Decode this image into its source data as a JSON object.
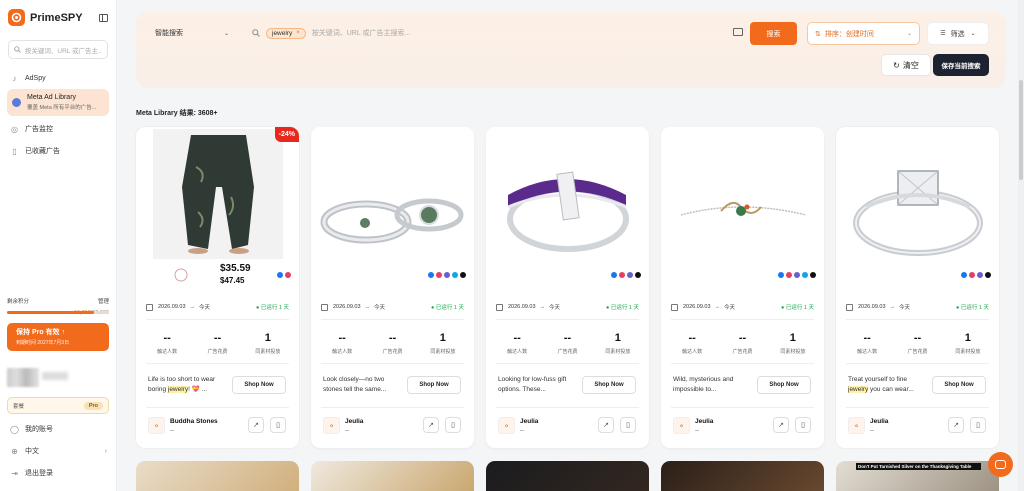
{
  "app": {
    "name": "PrimeSPY"
  },
  "sidebar": {
    "search_placeholder": "按关键词、URL 或广告主...",
    "items": [
      {
        "label": "AdSpy"
      },
      {
        "label": "Meta Ad Library",
        "sublabel": "覆盖 Meta 所有平台的广告..."
      },
      {
        "label": "广告监控"
      },
      {
        "label": "已收藏广告"
      }
    ],
    "credits": {
      "label": "剩余积分",
      "action": "管理",
      "used": "16,952",
      "total": "/20,000",
      "fraction": 0.85
    },
    "pro_button": {
      "label": "保持 Pro 有效 ↑",
      "expiry": "到期时间 2027年7月3日"
    },
    "plan": {
      "label": "套餐",
      "badge": "Pro"
    },
    "bottom": [
      {
        "label": "我的账号"
      },
      {
        "label": "中文",
        "chevron": "›"
      },
      {
        "label": "退出登录"
      }
    ]
  },
  "search": {
    "mode": "智能搜索",
    "chip": "jewelry",
    "placeholder": "按关键词、URL 或广告主搜索...",
    "search_button": "搜索",
    "sort_label": "排序：创建时间",
    "filter_label": "筛选",
    "clear_button": "清空",
    "save_button": "保存当前搜索"
  },
  "results": {
    "label": "Meta Library 结果: 3608+"
  },
  "stat_labels": [
    "触达人数",
    "广告花费",
    "同素材投放"
  ],
  "cards": [
    {
      "discount": "-24%",
      "price": "$35.59",
      "old_price": "$47.45",
      "date": "2026.09.03",
      "arrow": "→",
      "to": "今天",
      "running": "已运行 1 天",
      "stats": [
        "--",
        "--",
        "1"
      ],
      "copy_prefix": "Life is too short to wear boring ",
      "copy_highlight": "jewelry",
      "copy_suffix": "! 💝 ...",
      "shop": "Shop Now",
      "brand": "Buddha Stones",
      "brand_sub": "--",
      "socials": [
        "#1877f2",
        "#e4405f"
      ]
    },
    {
      "date": "2026.09.03",
      "arrow": "→",
      "to": "今天",
      "running": "已运行 1 天",
      "stats": [
        "--",
        "--",
        "1"
      ],
      "copy_prefix": "Look closely—no two stones tell the same...",
      "copy_highlight": "",
      "copy_suffix": "",
      "shop": "Shop Now",
      "brand": "Jeulia",
      "brand_sub": "--",
      "socials": [
        "#1877f2",
        "#e4405f",
        "#6b5ecf",
        "#0ea5e9",
        "#111111"
      ]
    },
    {
      "date": "2026.09.03",
      "arrow": "→",
      "to": "今天",
      "running": "已运行 1 天",
      "stats": [
        "--",
        "--",
        "1"
      ],
      "copy_prefix": "Looking for low-fuss gift options. These...",
      "copy_highlight": "",
      "copy_suffix": "",
      "shop": "Shop Now",
      "brand": "Jeulia",
      "brand_sub": "--",
      "socials": [
        "#1877f2",
        "#e4405f",
        "#6b5ecf",
        "#111111"
      ]
    },
    {
      "date": "2026.09.03",
      "arrow": "→",
      "to": "今天",
      "running": "已运行 1 天",
      "stats": [
        "--",
        "--",
        "1"
      ],
      "copy_prefix": "Wild, mysterious and impossible to...",
      "copy_highlight": "",
      "copy_suffix": "",
      "shop": "Shop Now",
      "brand": "Jeulia",
      "brand_sub": "--",
      "socials": [
        "#1877f2",
        "#e4405f",
        "#6b5ecf",
        "#0ea5e9",
        "#111111"
      ]
    },
    {
      "date": "2026.09.03",
      "arrow": "→",
      "to": "今天",
      "running": "已运行 1 天",
      "stats": [
        "--",
        "--",
        "1"
      ],
      "copy_prefix": "Treat yourself to fine ",
      "copy_highlight": "jewelry",
      "copy_suffix": " you can wear...",
      "shop": "Shop Now",
      "brand": "Jeulia",
      "brand_sub": "--",
      "socials": [
        "#1877f2",
        "#e4405f",
        "#6b5ecf",
        "#111111"
      ]
    }
  ],
  "bottom_ad_caption": "Don't Put Tarnished Silver on the Thanksgiving Table",
  "colors": {
    "accent": "#f26b1d",
    "dark": "#1d2230",
    "running": "#16a34a",
    "discount": "#e8281c"
  }
}
